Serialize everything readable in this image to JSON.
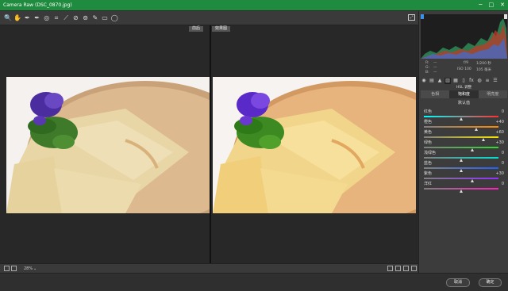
{
  "window": {
    "title": "Camera Raw (DSC_0870.jpg)",
    "minimize": "─",
    "maximize": "□",
    "close": "✕"
  },
  "toolbar": {
    "tools": [
      "zoom-icon",
      "hand-icon",
      "white-balance-icon",
      "color-sampler-icon",
      "target-adjust-icon",
      "crop-icon",
      "straighten-icon",
      "spot-removal-icon",
      "red-eye-icon",
      "adjustment-brush-icon",
      "graduated-filter-icon",
      "radial-filter-icon"
    ],
    "glyphs": [
      "🔍",
      "✋",
      "✒",
      "✒",
      "◎",
      "⌗",
      "⟋",
      "⊘",
      "⊚",
      "✎",
      "▭",
      "◯"
    ]
  },
  "preview": {
    "before_label": "前后",
    "after_label": "效果图"
  },
  "statusbar": {
    "zoom": "28%"
  },
  "camera_info": {
    "f_stop": "f/9",
    "shutter": "1/200 秒",
    "iso": "ISO 100",
    "lens": "105 毫米",
    "dash1": "—",
    "dash2": "—",
    "dash3": "—",
    "r": "R:",
    "g": "G:",
    "b": "B:"
  },
  "panel": {
    "title": "HSL 调整",
    "subtabs": [
      "色相",
      "饱和度",
      "明亮度"
    ],
    "active_subtab": 1,
    "default_link": "默认值",
    "sliders": [
      {
        "name": "红色",
        "value": "0",
        "pos": 0.5,
        "c1": "#00ffff",
        "c2": "#ff3030"
      },
      {
        "name": "橙色",
        "value": "+40",
        "pos": 0.7,
        "c1": "#808080",
        "c2": "#ff8a00"
      },
      {
        "name": "黄色",
        "value": "+60",
        "pos": 0.8,
        "c1": "#808080",
        "c2": "#f5e400"
      },
      {
        "name": "绿色",
        "value": "+30",
        "pos": 0.65,
        "c1": "#808080",
        "c2": "#2edb2e"
      },
      {
        "name": "浅绿色",
        "value": "0",
        "pos": 0.5,
        "c1": "#808080",
        "c2": "#00e0d0"
      },
      {
        "name": "蓝色",
        "value": "0",
        "pos": 0.5,
        "c1": "#808080",
        "c2": "#2060ff"
      },
      {
        "name": "紫色",
        "value": "+30",
        "pos": 0.65,
        "c1": "#808080",
        "c2": "#9030ff"
      },
      {
        "name": "洋红",
        "value": "0",
        "pos": 0.5,
        "c1": "#808080",
        "c2": "#ff20c0"
      }
    ]
  },
  "footer": {
    "cancel": "取消",
    "confirm": "确定"
  }
}
